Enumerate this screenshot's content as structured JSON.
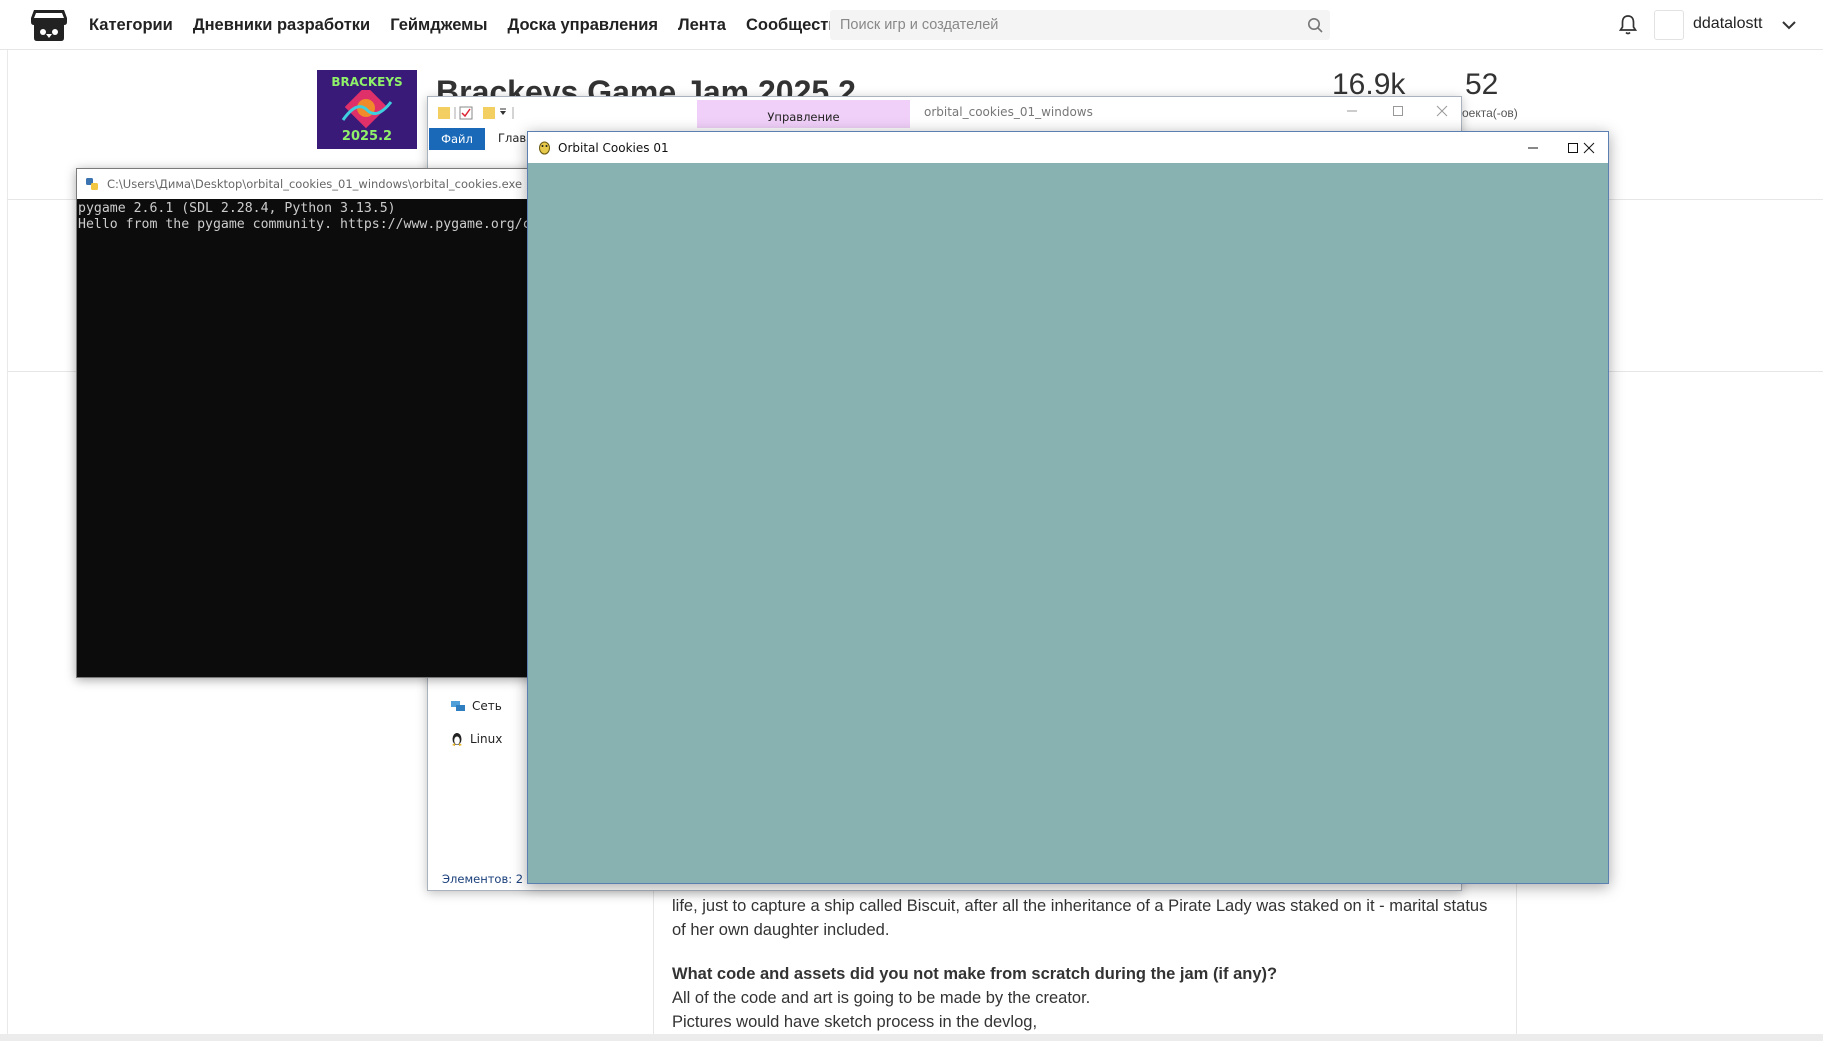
{
  "site": {
    "nav": [
      "Категории",
      "Дневники разработки",
      "Геймджемы",
      "Доска управления",
      "Лента",
      "Сообщество"
    ],
    "search_placeholder": "Поиск игр и создателей",
    "username": "ddatalostt",
    "icons": {
      "logo": "itchio-logo",
      "search": "search-icon",
      "bell": "bell-icon",
      "caret": "chevron-down-icon"
    }
  },
  "jam": {
    "thumb_top": "BRACKEYS",
    "thumb_bottom": "2025.2",
    "title": "Brackeys Game Jam 2025.2",
    "stats": [
      {
        "value": "16.9k",
        "label": ""
      },
      {
        "value": "52",
        "label": "оекта(-ов)"
      }
    ]
  },
  "content": {
    "para1": "life, just to capture a ship called Biscuit, after all the inheritance of a Pirate Lady was staked on it - marital status of her own daughter included.",
    "q2": "What code and assets did you not make from scratch during the jam (if any)?",
    "a2_line1": "All of the code and art is going to be made by the creator.",
    "a2_line2": "Pictures would have sketch process in the devlog,"
  },
  "explorer": {
    "ribbon_context_tab": "Управление",
    "path_title": "orbital_cookies_01_windows",
    "file_tab": "Файл",
    "home_tab": "Главн",
    "sidebar": [
      "Сеть",
      "Linux"
    ],
    "status": "Элементов: 2"
  },
  "console": {
    "title": "C:\\Users\\Дима\\Desktop\\orbital_cookies_01_windows\\orbital_cookies.exe",
    "lines": [
      "pygame 2.6.1 (SDL 2.28.4, Python 3.13.5)",
      "Hello from the pygame community. https://www.pygame.org/c"
    ]
  },
  "pygame_window": {
    "title": "Orbital Cookies 01",
    "canvas_color": "#88b2b2"
  }
}
